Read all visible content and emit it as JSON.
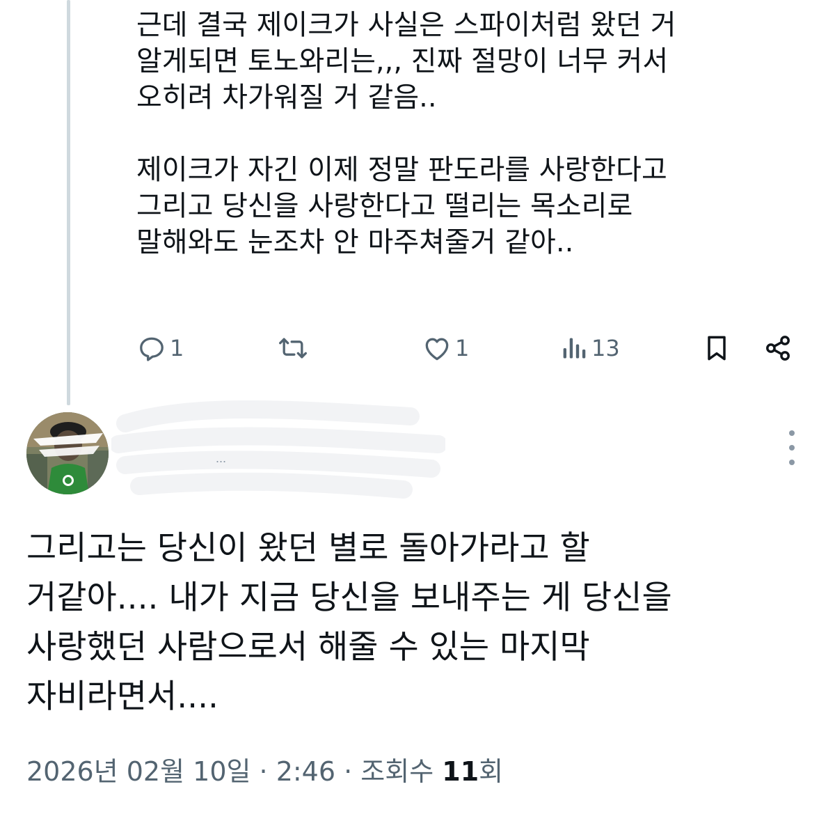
{
  "reply_tweet": {
    "text_lines_1": [
      "근데 결국 제이크가 사실은 스파이처럼 왔던 거",
      "알게되면 토노와리는,,, 진짜 절망이 너무 커서",
      "오히려 차가워질 거 같음.."
    ],
    "text_lines_2": [
      "제이크가 자긴 이제 정말 판도라를 사랑한다고",
      "그리고 당신을 사랑한다고 떨리는 목소리로",
      "말해와도 눈조차 안 마주쳐줄거 같아.."
    ],
    "actions": {
      "reply_count": "1",
      "like_count": "1",
      "views_count": "13"
    }
  },
  "main_tweet": {
    "author_name_visible": "...",
    "text_lines": [
      "그리고는 당신이 왔던 별로 돌아가라고 할",
      "거같아.... 내가 지금 당신을 보내주는 게 당신을",
      "사랑했던 사람으로서 해줄 수 있는 마지막",
      "자비라면서...."
    ],
    "meta": {
      "date": "2026년 02월 10일",
      "separator": " · ",
      "time": "2:46",
      "views_label": "조회수 ",
      "views_count": "11",
      "views_suffix": "회"
    }
  },
  "colors": {
    "text_primary": "#0f1419",
    "text_secondary": "#536471",
    "thread_line": "#cfd9de",
    "avatar_apron": "#2e8b3a"
  },
  "icons": {
    "reply": "speech-bubble-icon",
    "retweet": "retweet-icon",
    "like": "heart-icon",
    "views": "bar-chart-icon",
    "bookmark": "bookmark-icon",
    "share": "share-icon",
    "more": "vertical-dots-icon"
  }
}
